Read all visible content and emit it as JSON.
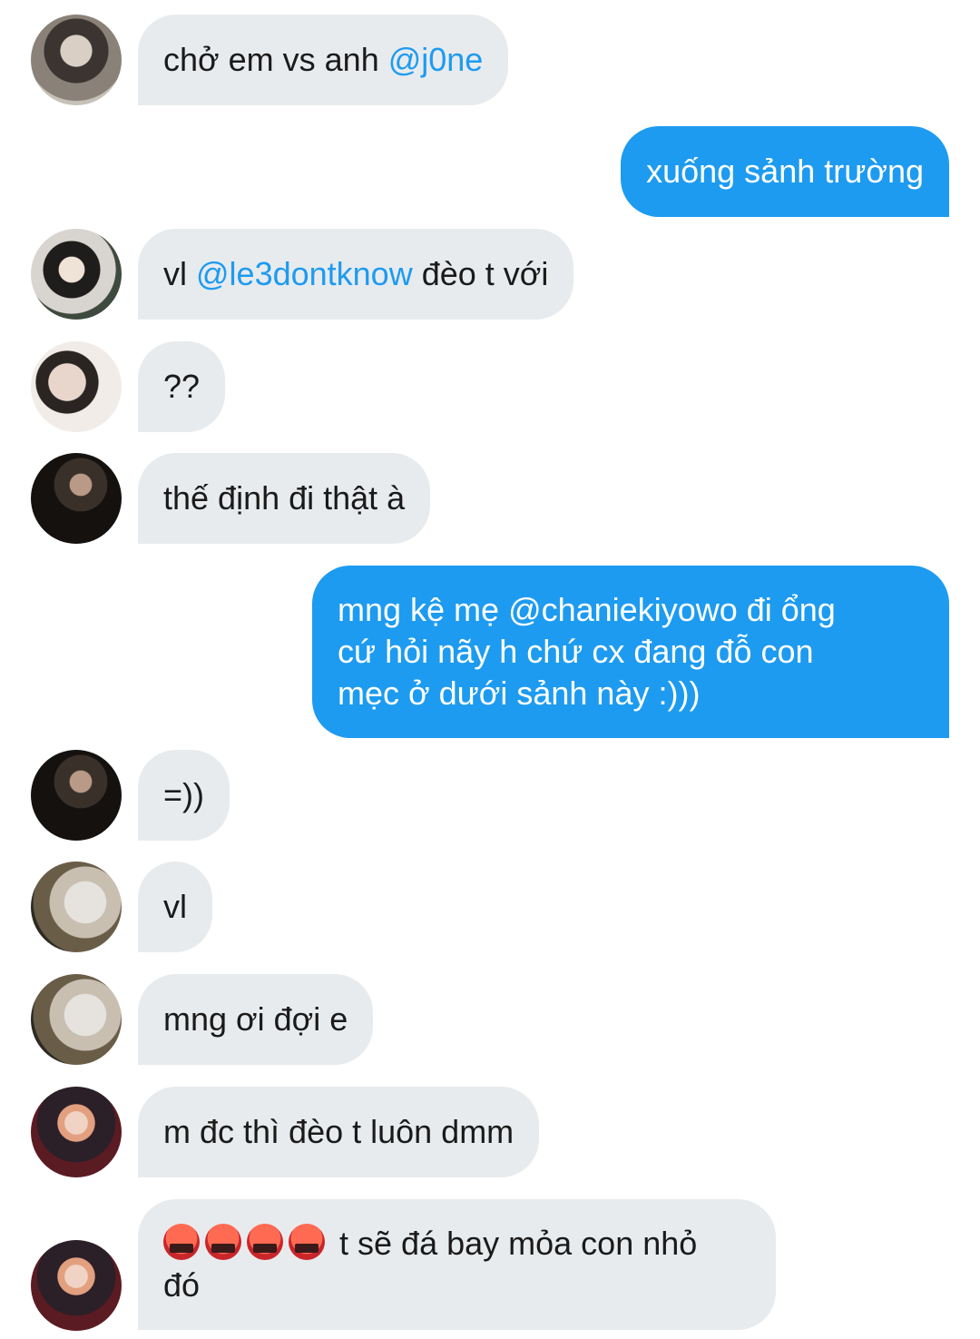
{
  "messages": [
    {
      "direction": "in",
      "avatar": "avatar-1",
      "text": "chở em vs anh ",
      "mention": "@j0ne",
      "text_after": ""
    },
    {
      "direction": "out",
      "text": "xuống sảnh trường"
    },
    {
      "direction": "in",
      "avatar": "avatar-2",
      "text": "vl ",
      "mention": "@le3dontknow",
      "text_after": " đèo t với"
    },
    {
      "direction": "in",
      "avatar": "avatar-3",
      "text": "??"
    },
    {
      "direction": "in",
      "avatar": "avatar-4",
      "text": "thế định đi thật à"
    },
    {
      "direction": "out",
      "lines": [
        "mng kệ mẹ @chaniekiyowo đi ổng",
        "cứ hỏi nãy h chứ cx đang đỗ con",
        "mẹc ở dưới sảnh này :)))"
      ]
    },
    {
      "direction": "in",
      "avatar": "avatar-4",
      "text": "=))"
    },
    {
      "direction": "in",
      "avatar": "avatar-5",
      "text": "vl"
    },
    {
      "direction": "in",
      "avatar": "avatar-5",
      "text": "mng ơi đợi e"
    },
    {
      "direction": "in",
      "avatar": "avatar-6",
      "text": "m đc thì đèo t luôn dmm"
    },
    {
      "direction": "in",
      "avatar": "avatar-6",
      "emoji": "face-with-symbols-on-mouth",
      "text": "t sẽ đá bay mỏa con nhỏ",
      "text_line2": "đó"
    }
  ],
  "colors": {
    "incoming_bubble": "#e8ebee",
    "outgoing_bubble": "#1d9bf0",
    "mention": "#1d9bf0",
    "background": "#ffffff"
  }
}
